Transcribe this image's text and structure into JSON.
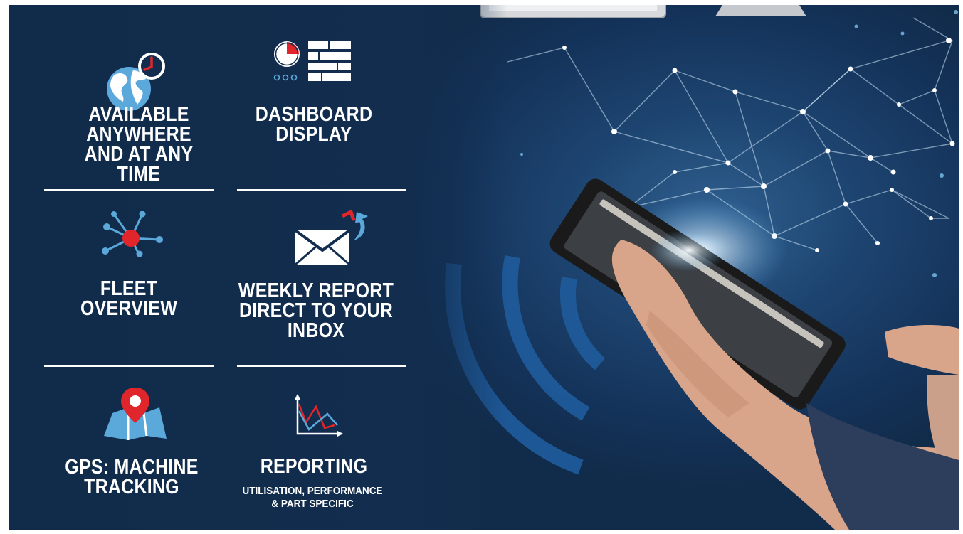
{
  "features": [
    {
      "id": "available",
      "title": "AVAILABLE\nANYWHERE\nAND AT ANY TIME",
      "icon": "globe-clock-icon"
    },
    {
      "id": "dashboard",
      "title": "DASHBOARD\nDISPLAY",
      "icon": "dashboard-icon"
    },
    {
      "id": "fleet",
      "title": "FLEET\nOVERVIEW",
      "icon": "network-node-icon"
    },
    {
      "id": "weekly",
      "title": "WEEKLY REPORT\nDIRECT TO YOUR\nINBOX",
      "icon": "envelope-arrow-icon"
    },
    {
      "id": "gps",
      "title": "GPS: MACHINE\nTRACKING",
      "icon": "map-pin-icon"
    },
    {
      "id": "reporting",
      "title": "REPORTING",
      "subtitle": "UTILISATION, PERFORMANCE\n& PART SPECIFIC",
      "icon": "line-graph-icon"
    }
  ],
  "colors": {
    "background": "#122d4e",
    "accent_red": "#e0262b",
    "accent_blue": "#5ba8db",
    "text": "#ffffff"
  }
}
